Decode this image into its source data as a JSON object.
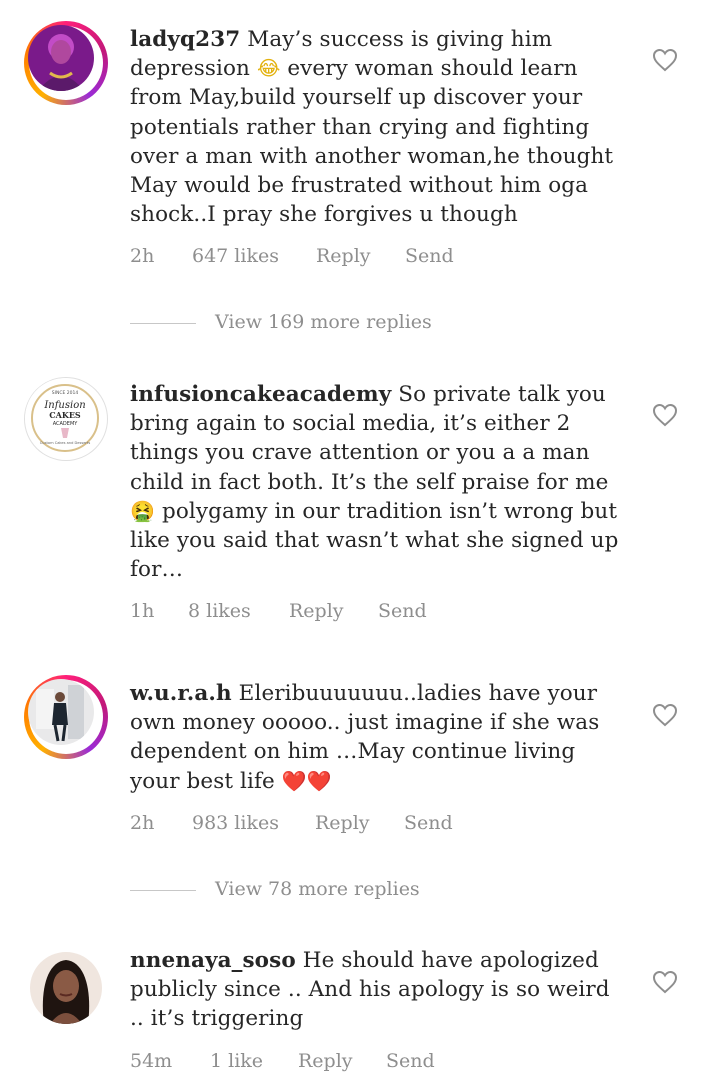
{
  "comments": [
    {
      "username": "ladyq237",
      "body": " May’s success is giving him depression",
      "emoji1": "😂",
      "body2": " every woman should learn from May,build yourself up discover your potentials rather than crying and fighting over a man with another woman,he thought May would be frustrated without him oga shock..I pray she forgives u though",
      "time": "2h",
      "likes": "647 likes",
      "reply": "Reply",
      "send": "Send",
      "view_replies": "View 169 more replies"
    },
    {
      "username": "infusioncakeacademy",
      "body": " So private talk you bring again to social media, it’s either 2 things you crave attention or you a a man child in fact both. It’s the self praise for me",
      "emoji1": "🤮",
      "body2": " polygamy in our tradition isn’t wrong but like you said that wasn’t what she signed up for…",
      "time": "1h",
      "likes": "8 likes",
      "reply": "Reply",
      "send": "Send",
      "avatar_text": {
        "top": "SINCE 2014",
        "line1": "Infusion",
        "line2": "CAKES",
        "line3": "ACADEMY",
        "bottom": "Custom Cakes and Desserts"
      }
    },
    {
      "username": "w.u.r.a.h",
      "body": " Eleribuuuuuuu..ladies have your own money ooooo.. just imagine if she was dependent on him …May continue living your best life",
      "emoji1": "❤️❤️",
      "time": "2h",
      "likes": "983 likes",
      "reply": "Reply",
      "send": "Send",
      "view_replies": "View 78 more replies"
    },
    {
      "username": "nnenaya_soso",
      "body": " He should have apologized publicly since .. And his apology is so weird .. it’s triggering",
      "time": "54m",
      "likes": "1 like",
      "reply": "Reply",
      "send": "Send"
    }
  ],
  "colors": {
    "text": "#262626",
    "meta": "#8e8e8e",
    "story_ring": "#c2187a"
  },
  "icons": {
    "like": "heart-outline-icon"
  }
}
